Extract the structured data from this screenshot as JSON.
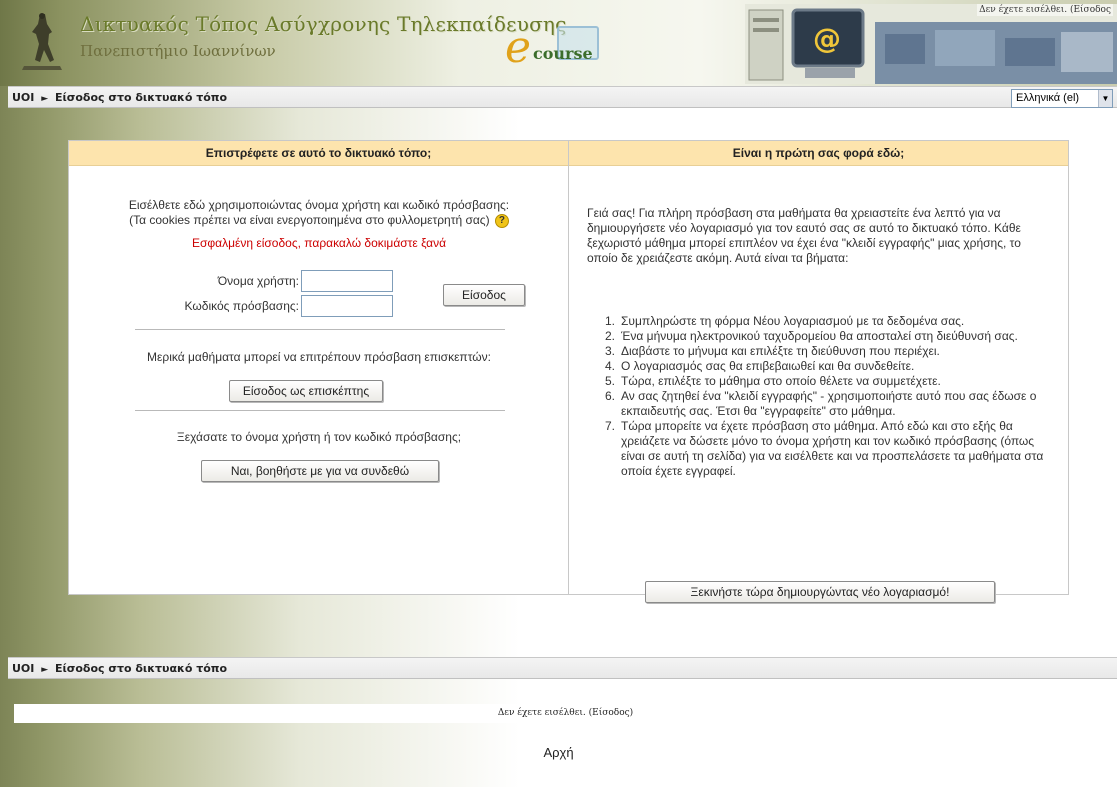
{
  "header": {
    "site_title": "Δικτυακός Τόπος Ασύγχρονης Τηλεκπαίδευσης",
    "site_subtitle": "Πανεπιστήμιο Ιωαννίνων",
    "logo_text": "course",
    "login_info": "Δεν έχετε εισέλθει. (Είσοδος"
  },
  "navbar": {
    "crumb_home": "UOI",
    "crumb_sep": "►",
    "crumb_current": "Είσοδος στο δικτυακό τόπο",
    "language": "Ελληνικά (el)"
  },
  "login": {
    "heading": "Επιστρέφετε σε αυτό το δικτυακό τόπο;",
    "intro_line1": "Εισέλθετε εδώ χρησιμοποιώντας όνομα χρήστη και κωδικό πρόσβασης:",
    "intro_line2": "(Τα cookies πρέπει να είναι ενεργοποιημένα στο φυλλομετρητή σας)",
    "help_glyph": "?",
    "error": "Εσφαλμένη είσοδος, παρακαλώ δοκιμάστε ξανά",
    "username_label": "Όνομα χρήστη:",
    "password_label": "Κωδικός πρόσβασης:",
    "username_value": "",
    "password_value": "",
    "login_button": "Είσοδος",
    "guest_text": "Μερικά μαθήματα μπορεί να επιτρέπουν πρόσβαση επισκεπτών:",
    "guest_button": "Είσοδος ως επισκέπτης",
    "forgot_text": "Ξεχάσατε το όνομα χρήστη ή τον κωδικό πρόσβασης;",
    "forgot_button": "Ναι, βοηθήστε με για να συνδεθώ"
  },
  "signup": {
    "heading": "Είναι η πρώτη σας φορά εδώ;",
    "intro": "Γειά σας! Για πλήρη πρόσβαση στα μαθήματα θα χρειαστείτε ένα λεπτό για να δημιουργήσετε νέο λογαριασμό για τον εαυτό σας σε αυτό το δικτυακό τόπο. Κάθε ξεχωριστό μάθημα μπορεί επιπλέον να έχει ένα \"κλειδί εγγραφής\" μιας χρήσης, το οποίο δε χρειάζεστε ακόμη. Αυτά είναι τα βήματα:",
    "steps": [
      {
        "num": "1.",
        "text": "Συμπληρώστε τη φόρμα Νέου λογαριασμού με τα δεδομένα σας."
      },
      {
        "num": "2.",
        "text": "Ένα μήνυμα ηλεκτρονικού ταχυδρομείου θα αποσταλεί στη διεύθυνσή σας."
      },
      {
        "num": "3.",
        "text": "Διαβάστε το μήνυμα και επιλέξτε τη διεύθυνση που περιέχει."
      },
      {
        "num": "4.",
        "text": "Ο λογαριασμός σας θα επιβεβαιωθεί και θα συνδεθείτε."
      },
      {
        "num": "5.",
        "text": "Τώρα, επιλέξτε το μάθημα στο οποίο θέλετε να συμμετέχετε."
      },
      {
        "num": "6.",
        "text": "Αν σας ζητηθεί ένα \"κλειδί εγγραφής\" - χρησιμοποιήστε αυτό που σας έδωσε ο εκπαιδευτής σας. Έτσι θα \"εγγραφείτε\" στο μάθημα."
      },
      {
        "num": "7.",
        "text": "Τώρα μπορείτε να έχετε πρόσβαση στο μάθημα. Από εδώ και στο εξής θα χρειάζετε να δώσετε μόνο το όνομα χρήστη και τον κωδικό πρόσβασης (όπως είναι σε αυτή τη σελίδα) για να εισέλθετε και να προσπελάσετε τα μαθήματα στα οποία έχετε εγγραφεί."
      }
    ],
    "signup_button": "Ξεκινήστε τώρα δημιουργώντας νέο λογαριασμό!"
  },
  "footer": {
    "crumb_home": "UOI",
    "crumb_sep": "►",
    "crumb_current": "Είσοδος στο δικτυακό τόπο",
    "login_info": "Δεν έχετε εισέλθει. (Είσοδος)",
    "home_link": "Αρχή"
  }
}
